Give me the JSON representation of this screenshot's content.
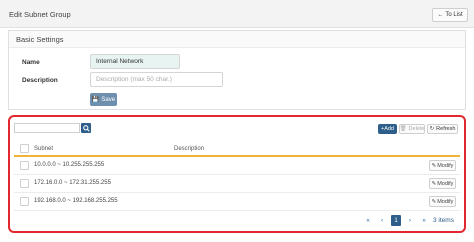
{
  "header": {
    "title": "Edit Subnet Group",
    "to_list_label": "To List"
  },
  "basic": {
    "title": "Basic Settings",
    "name_label": "Name",
    "name_value": "Internal Network",
    "description_label": "Description",
    "description_placeholder": "Description (max 50 char.)",
    "save_label": "Save"
  },
  "grid": {
    "add_label": "Add",
    "delete_label": "Delete",
    "refresh_label": "Refresh",
    "columns": {
      "subnet": "Subnet",
      "description": "Description"
    },
    "rows": [
      {
        "subnet": "10.0.0.0 ~ 10.255.255.255",
        "description": "",
        "action": "Modify"
      },
      {
        "subnet": "172.16.0.0 ~ 172.31.255.255",
        "description": "",
        "action": "Modify"
      },
      {
        "subnet": "192.168.0.0 ~ 192.168.255.255",
        "description": "",
        "action": "Modify"
      }
    ],
    "pager": {
      "first": "«",
      "prev": "‹",
      "current": "1",
      "next": "›",
      "last": "»",
      "items": "3 items"
    }
  },
  "colors": {
    "accent": "#2d5f8a",
    "highlight_border": "#e2282e",
    "header_underline": "#f1b33c"
  }
}
